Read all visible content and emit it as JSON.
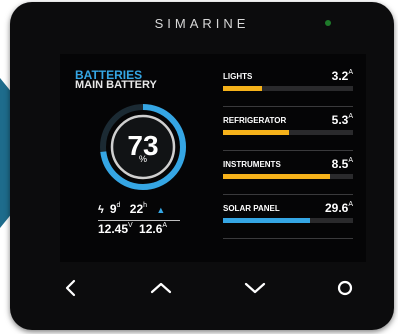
{
  "brand": "SIMARINE",
  "battery": {
    "title": "BATTERIES",
    "name": "MAIN BATTERY",
    "percent": 73,
    "percent_label": "73",
    "unit": "%",
    "days": "9",
    "days_unit": "d",
    "hours": "22",
    "hours_unit": "h",
    "voltage": "12.45",
    "voltage_unit": "V",
    "current": "12.6",
    "current_unit": "A"
  },
  "loads": [
    {
      "name": "LIGHTS",
      "value": "3.2",
      "unit": "A",
      "level": 0.3,
      "color": "#f6b21a"
    },
    {
      "name": "REFRIGERATOR",
      "value": "5.3",
      "unit": "A",
      "level": 0.51,
      "color": "#f6b21a"
    },
    {
      "name": "INSTRUMENTS",
      "value": "8.5",
      "unit": "A",
      "level": 0.82,
      "color": "#f6b21a"
    },
    {
      "name": "SOLAR PANEL",
      "value": "29.6",
      "unit": "A",
      "level": 0.67,
      "color": "#35a6e4"
    }
  ],
  "colors": {
    "accent": "#35a6e4",
    "consumer": "#f6b21a",
    "status_led": "#1e7b2a"
  },
  "nav": {
    "icons": [
      "chevron-left-icon",
      "chevron-up-icon",
      "chevron-down-icon",
      "circle-icon"
    ]
  }
}
